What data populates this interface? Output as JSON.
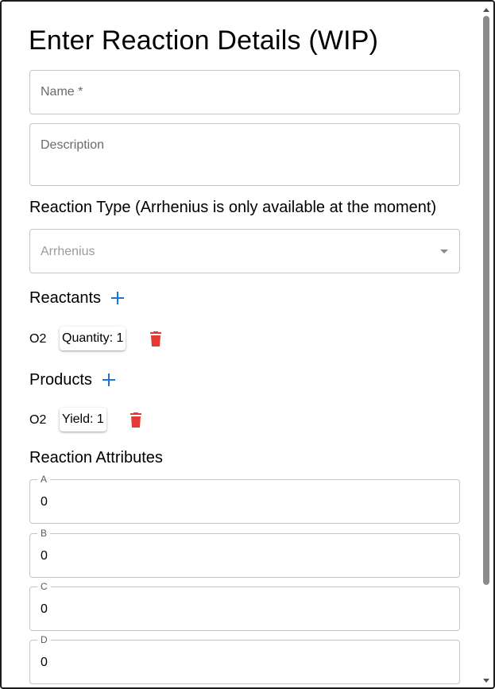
{
  "form": {
    "title": "Enter Reaction Details (WIP)",
    "name_placeholder": "Name *",
    "description_placeholder": "Description",
    "reaction_type_label": "Reaction Type (Arrhenius is only available at the moment)",
    "reaction_type_value": "Arrhenius",
    "reactants_label": "Reactants",
    "reactants": [
      {
        "name": "O2",
        "chip": "Quantity: 1"
      }
    ],
    "products_label": "Products",
    "products": [
      {
        "name": "O2",
        "chip": "Yield: 1"
      }
    ],
    "attributes_label": "Reaction Attributes",
    "attributes": [
      {
        "label": "A",
        "value": "0"
      },
      {
        "label": "B",
        "value": "0"
      },
      {
        "label": "C",
        "value": "0"
      },
      {
        "label": "D",
        "value": "0"
      }
    ]
  },
  "icons": {
    "add": "plus-icon",
    "delete": "trash-icon",
    "dropdown": "caret-down-icon"
  },
  "colors": {
    "accent": "#1976d2",
    "danger": "#e53935",
    "border": "#c4c4c4"
  }
}
